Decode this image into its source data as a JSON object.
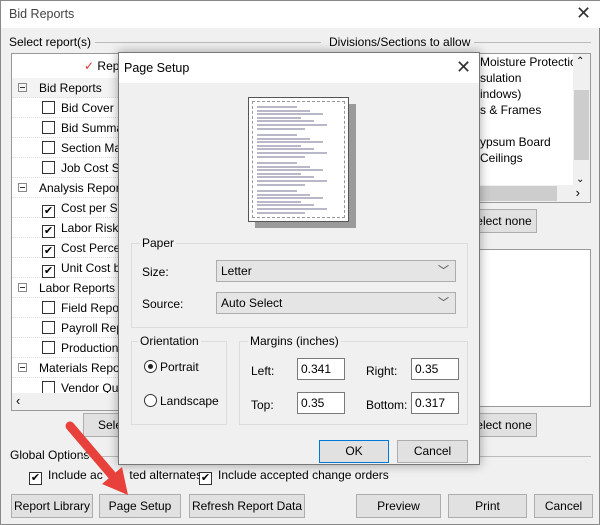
{
  "window": {
    "title": "Bid Reports",
    "close_icon": "close-icon"
  },
  "reports": {
    "label": "Select report(s)",
    "header_item": "Repo",
    "groups": [
      {
        "label": "Bid Reports",
        "items": [
          {
            "label": "Bid Cover Pa",
            "checked": false
          },
          {
            "label": "Bid Summary",
            "checked": false
          },
          {
            "label": "Section Mark",
            "checked": false
          },
          {
            "label": "Job Cost Sum",
            "checked": false
          }
        ]
      },
      {
        "label": "Analysis Reports",
        "items": [
          {
            "label": "Cost per Sq.",
            "checked": true
          },
          {
            "label": "Labor Risk",
            "checked": true
          },
          {
            "label": "Cost Percent",
            "checked": true
          },
          {
            "label": "Unit Cost by C",
            "checked": true
          }
        ]
      },
      {
        "label": "Labor Reports",
        "items": [
          {
            "label": "Field Report",
            "checked": false
          },
          {
            "label": "Payroll Repor",
            "checked": false
          },
          {
            "label": "Production R",
            "checked": false
          }
        ]
      },
      {
        "label": "Materials Reports",
        "items": [
          {
            "label": "Vendor Quot",
            "checked": false
          }
        ]
      }
    ],
    "select_all_label": "Sele"
  },
  "divisions": {
    "label": "Divisions/Sections to allow",
    "items": [
      "Moisture Protection)",
      "sulation",
      "indows)",
      "s & Frames",
      "",
      "ypsum Board",
      " Ceilings"
    ],
    "select_none_label": "elect none",
    "select_none_label_2": "elect none"
  },
  "global_options": {
    "label": "Global Options",
    "include_alternates": {
      "label": "Include ac        ted alternates",
      "checked": true
    },
    "include_change_orders": {
      "label": "Include accepted change orders",
      "checked": true
    }
  },
  "buttons": {
    "report_library": "Report Library",
    "page_setup": "Page Setup",
    "refresh": "Refresh Report Data",
    "preview": "Preview",
    "print": "Print",
    "cancel": "Cancel"
  },
  "page_setup": {
    "title": "Page Setup",
    "paper": {
      "label": "Paper",
      "size_label": "Size:",
      "size_value": "Letter",
      "source_label": "Source:",
      "source_value": "Auto Select"
    },
    "orientation": {
      "label": "Orientation",
      "portrait": "Portrait",
      "landscape": "Landscape",
      "selected": "Portrait"
    },
    "margins": {
      "label": "Margins (inches)",
      "left_label": "Left:",
      "left": "0.341",
      "right_label": "Right:",
      "right": "0.35",
      "top_label": "Top:",
      "top": "0.35",
      "bottom_label": "Bottom:",
      "bottom": "0.317"
    },
    "ok": "OK",
    "cancel": "Cancel"
  },
  "annotation": {
    "arrow_color": "#e8413c"
  },
  "colors": {
    "check_accent": "#e03030"
  }
}
